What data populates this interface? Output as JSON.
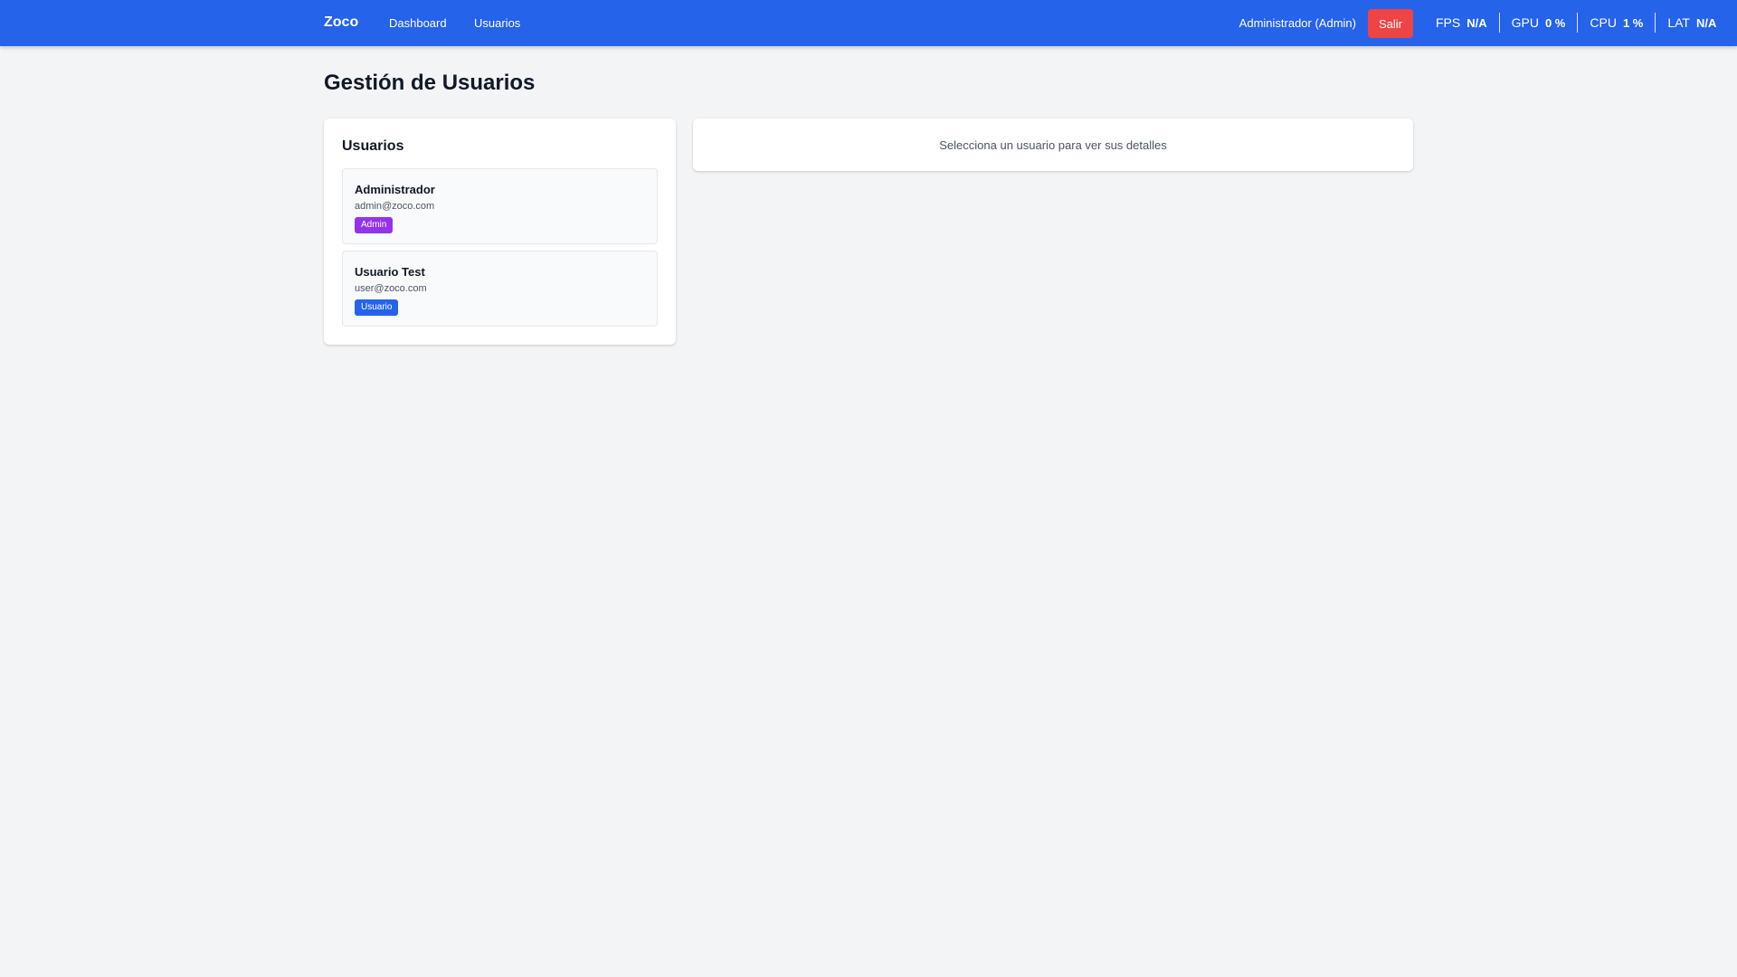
{
  "navbar": {
    "brand": "Zoco",
    "links": [
      {
        "label": "Dashboard"
      },
      {
        "label": "Usuarios"
      }
    ],
    "current_user": "Administrador (Admin)",
    "logout_label": "Salir",
    "metrics": [
      {
        "label": "FPS",
        "value": "N/A"
      },
      {
        "label": "GPU",
        "value": "0 %"
      },
      {
        "label": "CPU",
        "value": "1 %"
      },
      {
        "label": "LAT",
        "value": "N/A"
      }
    ]
  },
  "page": {
    "title": "Gestión de Usuarios"
  },
  "users_panel": {
    "title": "Usuarios",
    "users": [
      {
        "name": "Administrador",
        "email": "admin@zoco.com",
        "role": "Admin",
        "role_color": "#9333ea"
      },
      {
        "name": "Usuario Test",
        "email": "user@zoco.com",
        "role": "Usuario",
        "role_color": "#2563eb"
      }
    ]
  },
  "details_panel": {
    "empty_message": "Selecciona un usuario para ver sus detalles"
  },
  "colors": {
    "navbar_bg": "#2563eb",
    "logout_bg": "#ef4444",
    "page_bg": "#f3f4f6"
  }
}
